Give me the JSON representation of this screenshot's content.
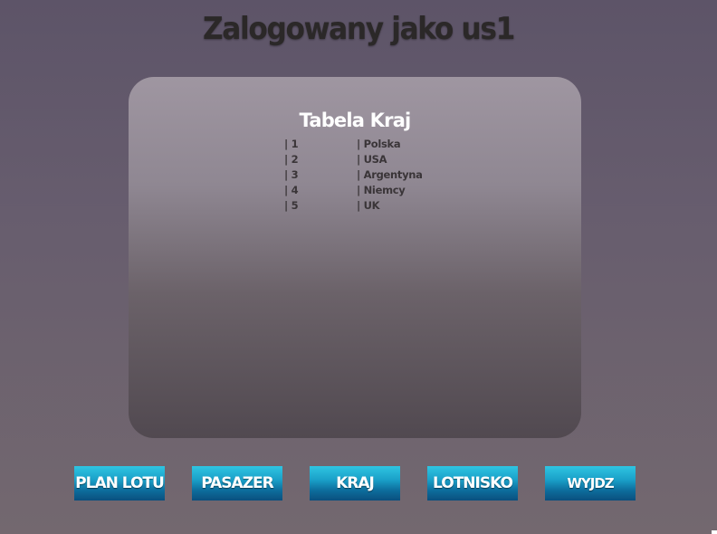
{
  "header": {
    "title": "Zalogowany jako us1"
  },
  "panel": {
    "title": "Tabela Kraj",
    "rows": [
      {
        "id": "| 1",
        "name": "| Polska"
      },
      {
        "id": "| 2",
        "name": "| USA"
      },
      {
        "id": "| 3",
        "name": "| Argentyna"
      },
      {
        "id": "| 4",
        "name": "| Niemcy"
      },
      {
        "id": "| 5",
        "name": "| UK"
      }
    ]
  },
  "nav": {
    "items": [
      {
        "label": "PLAN LOTU"
      },
      {
        "label": "PASAZER"
      },
      {
        "label": "KRAJ"
      },
      {
        "label": "LOTNISKO"
      },
      {
        "label": "WYJDZ"
      }
    ]
  },
  "colors": {
    "button_top": "#2fc5e2",
    "button_bottom": "#0a4f7e",
    "title_text": "#2b2828",
    "table_text": "#3a3538"
  }
}
